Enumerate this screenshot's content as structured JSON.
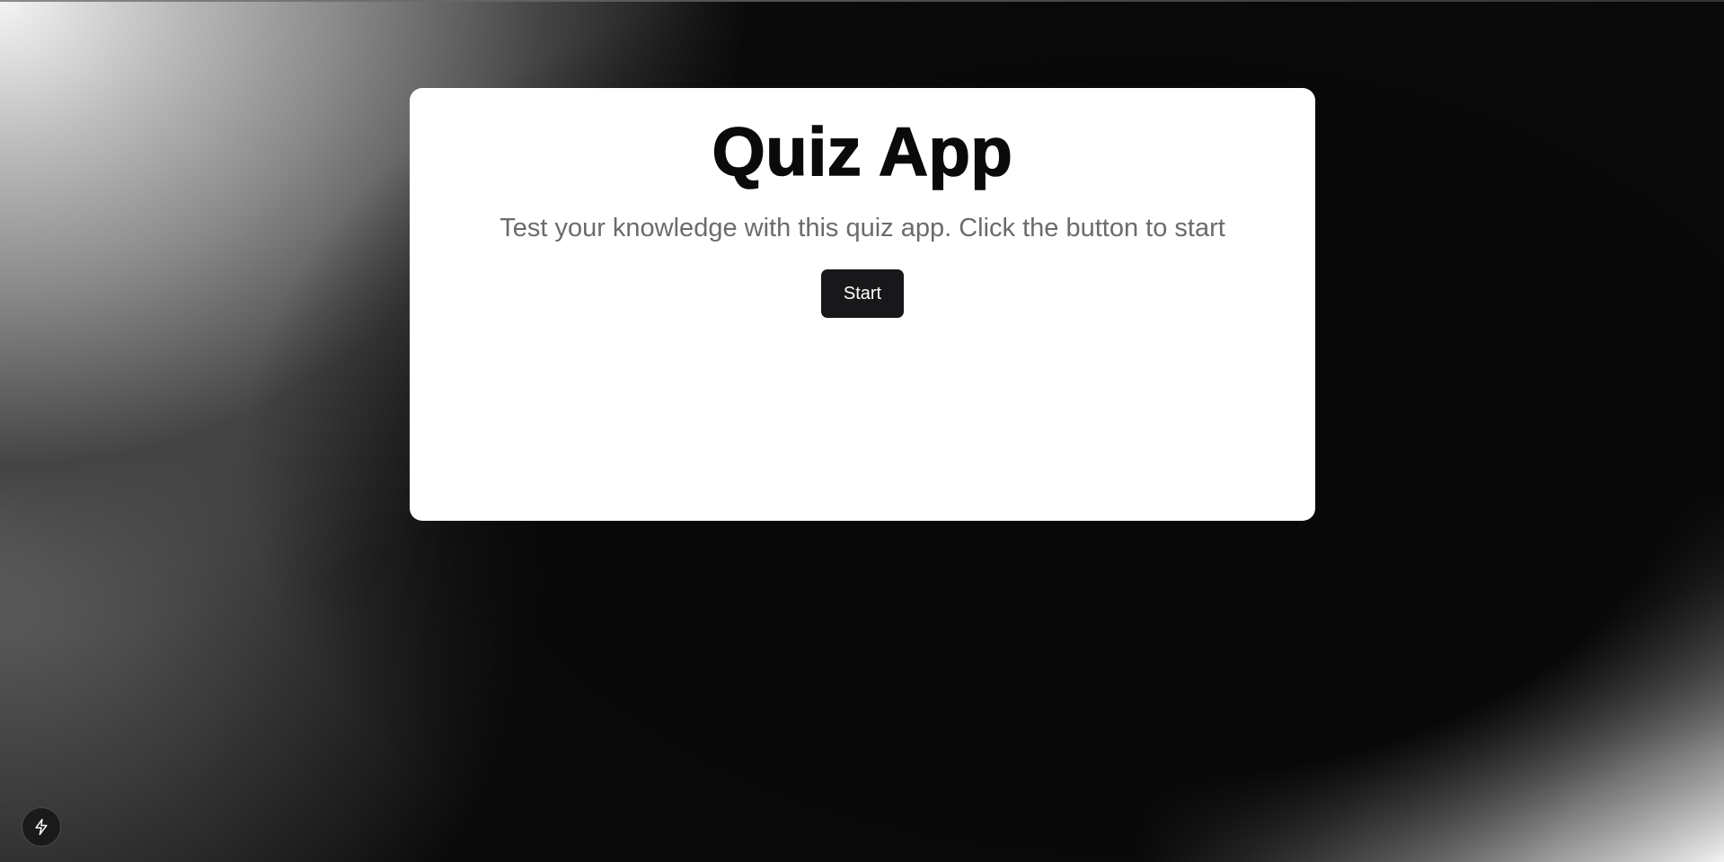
{
  "app": {
    "title": "Quiz App",
    "description": "Test your knowledge with this quiz app. Click the button to start",
    "start_label": "Start"
  },
  "floating_button": {
    "icon": "lightning-bolt-icon"
  },
  "colors": {
    "card_background": "#ffffff",
    "button_background": "#18181b",
    "title_color": "#0a0a0a",
    "description_color": "#6b6b6b"
  }
}
